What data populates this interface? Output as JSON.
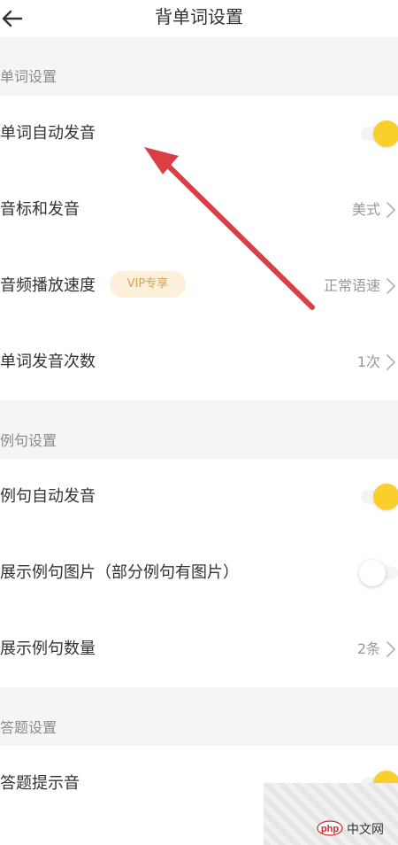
{
  "header": {
    "title": "背单词设置",
    "back_icon": "arrow-left-icon"
  },
  "sections": [
    {
      "title": "单词设置"
    },
    {
      "title": "例句设置"
    },
    {
      "title": "答题设置"
    }
  ],
  "rows": [
    {
      "label": "单词自动发音",
      "type": "toggle",
      "on": true
    },
    {
      "label": "音标和发音",
      "type": "select",
      "value": "美式"
    },
    {
      "label": "音频播放速度",
      "type": "select",
      "value": "正常语速",
      "badge": "VIP专享"
    },
    {
      "label": "单词发音次数",
      "type": "select",
      "value": "1次"
    },
    {
      "label": "例句自动发音",
      "type": "toggle",
      "on": true
    },
    {
      "label": "展示例句图片（部分例句有图片）",
      "type": "toggle",
      "on": false
    },
    {
      "label": "展示例句数量",
      "type": "select",
      "value": "2条"
    },
    {
      "label": "答题提示音",
      "type": "toggle",
      "on": true
    }
  ],
  "watermark": {
    "text": "中文网",
    "logo": "php"
  },
  "colors": {
    "toggle_on": "#f9d02b",
    "annotation_arrow": "#d93f45",
    "vip_badge_bg": "#fdf0db",
    "vip_badge_text": "#d6a35b"
  }
}
